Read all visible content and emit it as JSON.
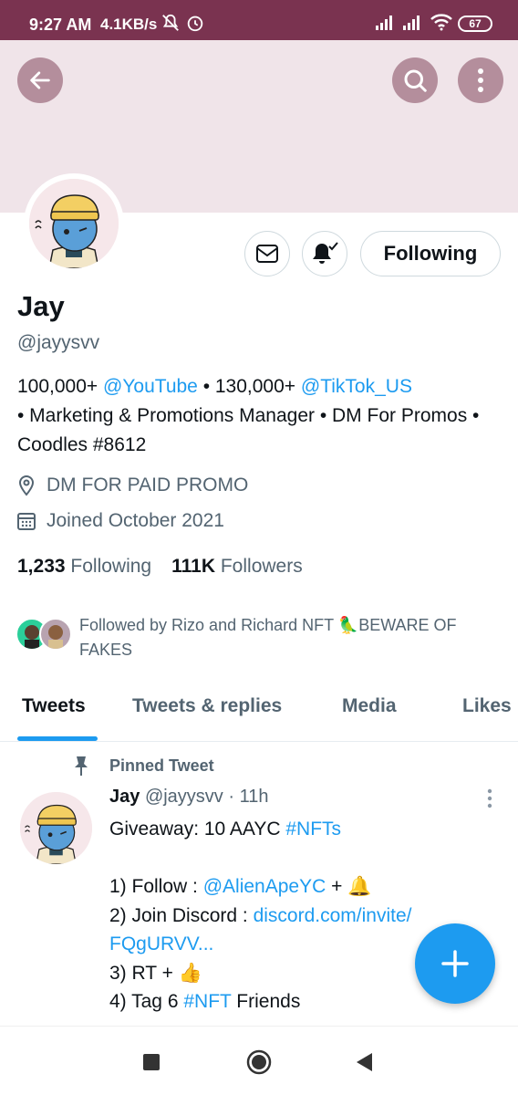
{
  "status_bar": {
    "time": "9:27 AM",
    "speed": "4.1KB/s",
    "battery": "67",
    "icons": [
      "mute-icon",
      "alarm-icon",
      "signal-icon",
      "signal-icon",
      "wifi-icon",
      "battery-icon"
    ]
  },
  "header": {
    "back_icon": "arrow-left-icon",
    "search_icon": "search-icon",
    "more_icon": "more-vertical-icon"
  },
  "profile": {
    "name": "Jay",
    "handle": "@jayysvv",
    "following_button": "Following",
    "bio": {
      "part1": "100,000+ ",
      "youtube": "@YouTube",
      "part2": " • 130,000+ ",
      "tiktok": "@TikTok_US",
      "part3": "• Marketing & Promotions Manager • DM For Promos • Coodles #8612"
    },
    "location": "DM FOR PAID PROMO",
    "joined": "Joined October 2021",
    "following_count": "1,233",
    "following_label": "Following",
    "followers_count": "111K",
    "followers_label": "Followers",
    "followed_by": "Followed by Rizo and Richard NFT 🦜BEWARE OF FAKES"
  },
  "tabs": [
    "Tweets",
    "Tweets & replies",
    "Media",
    "Likes"
  ],
  "tweet": {
    "pinned_label": "Pinned Tweet",
    "author": "Jay",
    "meta": "@jayysvv · 11h",
    "line1_text": "Giveaway: 10 AAYC ",
    "line1_tag": "#NFTs",
    "line2_text": "1) Follow : ",
    "line2_mention": "@AlienApeYC",
    "line2_end": " + 🔔",
    "line3_text": "2) Join Discord : ",
    "line3_link": "discord.com/invite/",
    "line4_link": "FQgURVV...",
    "line5_text": "3) RT + 👍",
    "line6_text": "4) Tag 6 ",
    "line6_tag": "#NFT",
    "line6_end": " Friends"
  },
  "colors": {
    "status_bar": "#7a3350",
    "banner": "#f0e4e9",
    "accent": "#1d9bf0",
    "muted": "#536471"
  }
}
